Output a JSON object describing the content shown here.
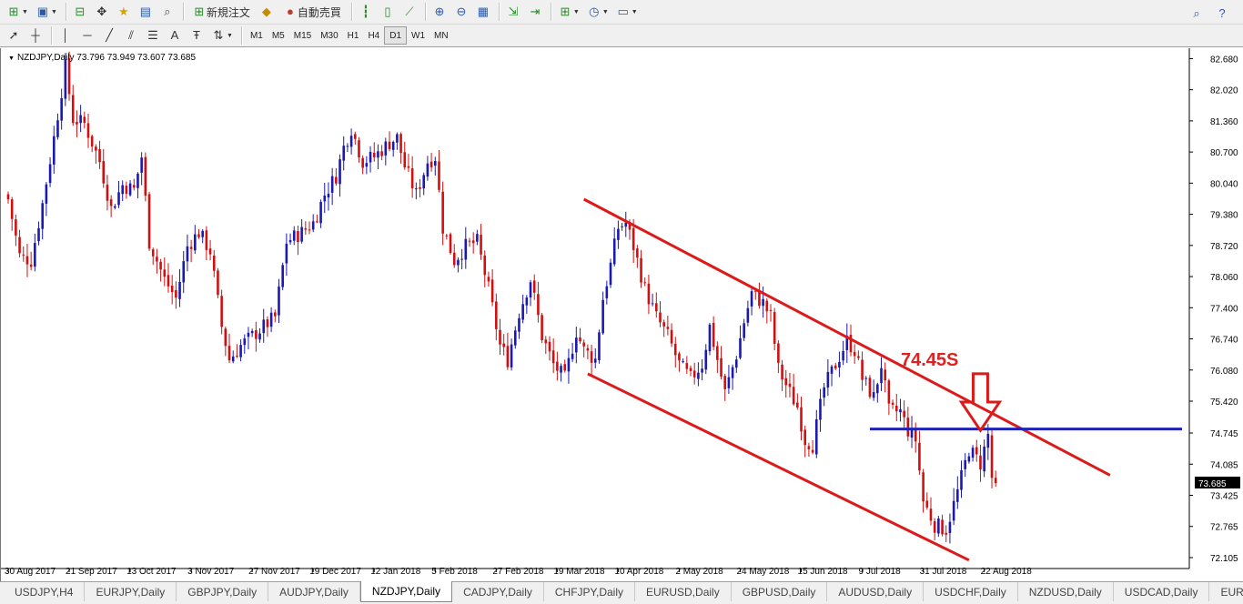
{
  "toolbar1": {
    "new_order_label": "新規注文",
    "auto_trade_label": "自動売買"
  },
  "toolbar2": {
    "timeframes": [
      "M1",
      "M5",
      "M15",
      "M30",
      "H1",
      "H4",
      "D1",
      "W1",
      "MN"
    ],
    "active_timeframe": "D1"
  },
  "chart": {
    "symbol_info": "NZDJPY,Daily  73.796 73.949 73.607 73.685",
    "current_price_label": "73.685",
    "annotation": "74.45S",
    "colors": {
      "bull": "#1a1ab0",
      "bear": "#d01010",
      "channel": "#dd1a1a",
      "hline": "#1e22b8",
      "price_tag_bg": "#000000"
    }
  },
  "chart_data": {
    "type": "candlestick",
    "symbol": "NZDJPY",
    "timeframe": "Daily",
    "ohlc_current": {
      "open": 73.796,
      "high": 73.949,
      "low": 73.607,
      "close": 73.685
    },
    "y_ticks": [
      82.68,
      82.02,
      81.36,
      80.7,
      80.04,
      79.38,
      78.72,
      78.06,
      77.4,
      76.74,
      76.08,
      75.42,
      74.745,
      74.085,
      73.425,
      72.765,
      72.105
    ],
    "y_tick_labels": [
      "82.680",
      "82.020",
      "81.360",
      "80.700",
      "80.040",
      "79.380",
      "78.720",
      "78.060",
      "77.400",
      "76.740",
      "76.080",
      "75.420",
      "74.745",
      "74.085",
      "73.425",
      "72.765",
      "72.105"
    ],
    "ylim": [
      71.95,
      82.9
    ],
    "x_tick_labels": [
      "30 Aug 2017",
      "21 Sep 2017",
      "13 Oct 2017",
      "3 Nov 2017",
      "27 Nov 2017",
      "19 Dec 2017",
      "12 Jan 2018",
      "5 Feb 2018",
      "27 Feb 2018",
      "19 Mar 2018",
      "10 Apr 2018",
      "2 May 2018",
      "24 May 2018",
      "15 Jun 2018",
      "9 Jul 2018",
      "31 Jul 2018",
      "22 Aug 2018"
    ],
    "x_tick_index": [
      0,
      16,
      32,
      48,
      64,
      80,
      96,
      112,
      128,
      144,
      160,
      176,
      192,
      208,
      224,
      240,
      256
    ],
    "anchors": [
      {
        "i": 0,
        "p": 79.7
      },
      {
        "i": 3,
        "p": 78.5
      },
      {
        "i": 6,
        "p": 78.4
      },
      {
        "i": 9,
        "p": 79.6
      },
      {
        "i": 12,
        "p": 81.0
      },
      {
        "i": 15,
        "p": 82.5
      },
      {
        "i": 17,
        "p": 81.4
      },
      {
        "i": 20,
        "p": 81.3
      },
      {
        "i": 24,
        "p": 80.5
      },
      {
        "i": 27,
        "p": 79.5
      },
      {
        "i": 30,
        "p": 80.0
      },
      {
        "i": 33,
        "p": 79.9
      },
      {
        "i": 35,
        "p": 80.6
      },
      {
        "i": 37,
        "p": 78.8
      },
      {
        "i": 41,
        "p": 78.0
      },
      {
        "i": 44,
        "p": 77.6
      },
      {
        "i": 47,
        "p": 78.7
      },
      {
        "i": 50,
        "p": 79.0
      },
      {
        "i": 53,
        "p": 78.6
      },
      {
        "i": 56,
        "p": 77.0
      },
      {
        "i": 58,
        "p": 76.3
      },
      {
        "i": 61,
        "p": 76.6
      },
      {
        "i": 64,
        "p": 76.8
      },
      {
        "i": 67,
        "p": 77.0
      },
      {
        "i": 70,
        "p": 77.2
      },
      {
        "i": 73,
        "p": 78.8
      },
      {
        "i": 77,
        "p": 79.0
      },
      {
        "i": 80,
        "p": 79.2
      },
      {
        "i": 83,
        "p": 79.8
      },
      {
        "i": 86,
        "p": 80.2
      },
      {
        "i": 88,
        "p": 80.8
      },
      {
        "i": 90,
        "p": 81.2
      },
      {
        "i": 93,
        "p": 80.5
      },
      {
        "i": 96,
        "p": 80.6
      },
      {
        "i": 100,
        "p": 80.9
      },
      {
        "i": 102,
        "p": 81.0
      },
      {
        "i": 104,
        "p": 80.4
      },
      {
        "i": 107,
        "p": 79.8
      },
      {
        "i": 110,
        "p": 80.5
      },
      {
        "i": 112,
        "p": 80.6
      },
      {
        "i": 114,
        "p": 79.1
      },
      {
        "i": 117,
        "p": 78.4
      },
      {
        "i": 120,
        "p": 78.7
      },
      {
        "i": 123,
        "p": 78.8
      },
      {
        "i": 126,
        "p": 77.8
      },
      {
        "i": 129,
        "p": 76.6
      },
      {
        "i": 131,
        "p": 76.3
      },
      {
        "i": 134,
        "p": 77.3
      },
      {
        "i": 137,
        "p": 78.0
      },
      {
        "i": 140,
        "p": 76.8
      },
      {
        "i": 143,
        "p": 76.2
      },
      {
        "i": 146,
        "p": 75.9
      },
      {
        "i": 149,
        "p": 76.9
      },
      {
        "i": 151,
        "p": 76.5
      },
      {
        "i": 154,
        "p": 76.3
      },
      {
        "i": 156,
        "p": 77.6
      },
      {
        "i": 158,
        "p": 78.3
      },
      {
        "i": 160,
        "p": 79.1
      },
      {
        "i": 162,
        "p": 79.2
      },
      {
        "i": 164,
        "p": 78.7
      },
      {
        "i": 167,
        "p": 77.8
      },
      {
        "i": 170,
        "p": 77.2
      },
      {
        "i": 173,
        "p": 76.8
      },
      {
        "i": 176,
        "p": 76.2
      },
      {
        "i": 179,
        "p": 75.9
      },
      {
        "i": 182,
        "p": 76.2
      },
      {
        "i": 184,
        "p": 77.0
      },
      {
        "i": 186,
        "p": 76.3
      },
      {
        "i": 188,
        "p": 75.6
      },
      {
        "i": 191,
        "p": 76.4
      },
      {
        "i": 193,
        "p": 77.1
      },
      {
        "i": 195,
        "p": 77.7
      },
      {
        "i": 198,
        "p": 77.5
      },
      {
        "i": 200,
        "p": 77.2
      },
      {
        "i": 202,
        "p": 76.1
      },
      {
        "i": 205,
        "p": 75.6
      },
      {
        "i": 207,
        "p": 75.3
      },
      {
        "i": 209,
        "p": 74.6
      },
      {
        "i": 211,
        "p": 74.5
      },
      {
        "i": 214,
        "p": 75.7
      },
      {
        "i": 217,
        "p": 76.2
      },
      {
        "i": 220,
        "p": 76.7
      },
      {
        "i": 222,
        "p": 76.5
      },
      {
        "i": 224,
        "p": 75.9
      },
      {
        "i": 227,
        "p": 75.5
      },
      {
        "i": 229,
        "p": 76.2
      },
      {
        "i": 231,
        "p": 75.2
      },
      {
        "i": 234,
        "p": 75.2
      },
      {
        "i": 236,
        "p": 74.8
      },
      {
        "i": 238,
        "p": 74.6
      },
      {
        "i": 240,
        "p": 73.3
      },
      {
        "i": 243,
        "p": 72.8
      },
      {
        "i": 246,
        "p": 72.7
      },
      {
        "i": 249,
        "p": 73.5
      },
      {
        "i": 252,
        "p": 74.4
      },
      {
        "i": 255,
        "p": 74.1
      },
      {
        "i": 257,
        "p": 74.7
      },
      {
        "i": 258,
        "p": 73.8
      },
      {
        "i": 259,
        "p": 73.685
      }
    ],
    "channel_upper": [
      {
        "i": 151,
        "p": 79.7
      },
      {
        "i": 289,
        "p": 73.85
      }
    ],
    "channel_lower": [
      {
        "i": 152,
        "p": 76.0
      },
      {
        "i": 252,
        "p": 72.05
      }
    ],
    "horizontal_level": {
      "p": 74.83,
      "from_i": 226,
      "to_i": 308
    },
    "arrow_marker": {
      "i": 255,
      "p_top": 76.0,
      "p_tip": 74.8
    }
  },
  "tabs": [
    "USDJPY,H4",
    "EURJPY,Daily",
    "GBPJPY,Daily",
    "AUDJPY,Daily",
    "NZDJPY,Daily",
    "CADJPY,Daily",
    "CHFJPY,Daily",
    "EURUSD,Daily",
    "GBPUSD,Daily",
    "AUDUSD,Daily",
    "USDCHF,Daily",
    "NZDUSD,Daily",
    "USDCAD,Daily",
    "EURGBP,Daily"
  ],
  "active_tab": "NZDJPY,Daily"
}
